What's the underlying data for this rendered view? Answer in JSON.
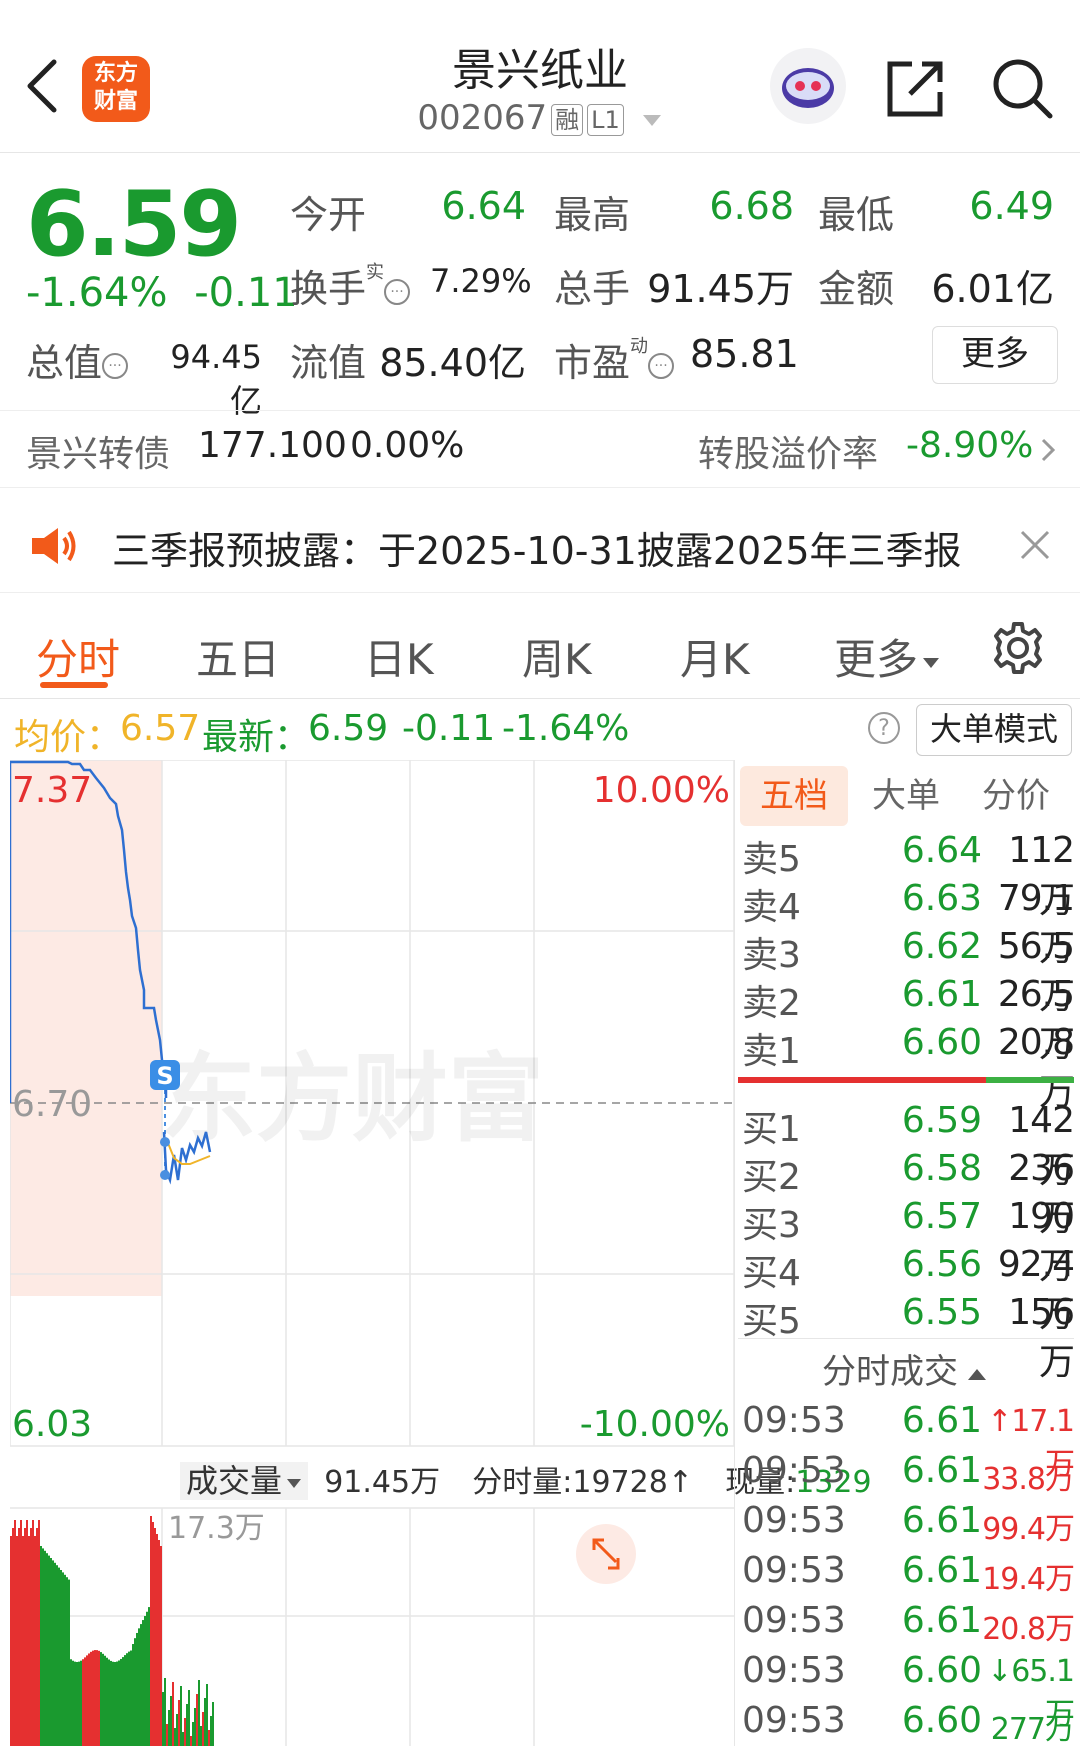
{
  "header": {
    "logo_text_1": "东方",
    "logo_text_2": "财富",
    "stock_name": "景兴纸业",
    "stock_code": "002067",
    "tag_margin": "融",
    "tag_level": "L1"
  },
  "quote": {
    "price": "6.59",
    "change_pct": "-1.64%",
    "change": "-0.11",
    "open_label": "今开",
    "open": "6.64",
    "high_label": "最高",
    "high": "6.68",
    "low_label": "最低",
    "low": "6.49",
    "turnover_label": "换手",
    "turnover_sup": "实",
    "turnover": "7.29%",
    "volume_label": "总手",
    "volume": "91.45万",
    "amount_label": "金额",
    "amount": "6.01亿",
    "mktcap_label": "总值",
    "mktcap": "94.45亿",
    "float_label": "流值",
    "float_cap": "85.40亿",
    "pe_label": "市盈",
    "pe_sup": "动",
    "pe": "85.81",
    "more_button": "更多"
  },
  "bond": {
    "name": "景兴转债",
    "price": "177.100",
    "change": "0.00%",
    "premium_label": "转股溢价率",
    "premium": "-8.90%"
  },
  "notice": {
    "text": "三季报预披露：于2025-10-31披露2025年三季报"
  },
  "tabs": [
    "分时",
    "五日",
    "日K",
    "周K",
    "月K",
    "更多"
  ],
  "info_line": {
    "avg_label": "均价：",
    "avg": "6.57",
    "latest_label": "最新：",
    "latest": "6.59",
    "change": "-0.11",
    "change_pct": "-1.64%",
    "mode_button": "大单模式"
  },
  "depth": {
    "tabs": [
      "五档",
      "大单",
      "分价"
    ],
    "asks": [
      {
        "label": "卖5",
        "price": "6.64",
        "vol": "112万"
      },
      {
        "label": "卖4",
        "price": "6.63",
        "vol": "79.1万"
      },
      {
        "label": "卖3",
        "price": "6.62",
        "vol": "56.5万"
      },
      {
        "label": "卖2",
        "price": "6.61",
        "vol": "26.5万"
      },
      {
        "label": "卖1",
        "price": "6.60",
        "vol": "20.8万"
      }
    ],
    "bids": [
      {
        "label": "买1",
        "price": "6.59",
        "vol": "142万"
      },
      {
        "label": "买2",
        "price": "6.58",
        "vol": "236万"
      },
      {
        "label": "买3",
        "price": "6.57",
        "vol": "190万"
      },
      {
        "label": "买4",
        "price": "6.56",
        "vol": "92.4万"
      },
      {
        "label": "买5",
        "price": "6.55",
        "vol": "156万"
      }
    ],
    "ticks_title": "分时成交",
    "ticks": [
      {
        "time": "09:53",
        "price": "6.61",
        "arrow": "↑",
        "vol": "17.1万",
        "color": "red"
      },
      {
        "time": "09:53",
        "price": "6.61",
        "arrow": "",
        "vol": "33.8万",
        "color": "red"
      },
      {
        "time": "09:53",
        "price": "6.61",
        "arrow": "",
        "vol": "99.4万",
        "color": "red"
      },
      {
        "time": "09:53",
        "price": "6.61",
        "arrow": "",
        "vol": "19.4万",
        "color": "red"
      },
      {
        "time": "09:53",
        "price": "6.61",
        "arrow": "",
        "vol": "20.8万",
        "color": "red"
      },
      {
        "time": "09:53",
        "price": "6.60",
        "arrow": "↓",
        "vol": "65.1万",
        "color": "green"
      },
      {
        "time": "09:53",
        "price": "6.60",
        "arrow": "",
        "vol": "277万",
        "color": "green"
      }
    ]
  },
  "chart": {
    "y_max": "7.37",
    "y_mid": "6.70",
    "y_min": "6.03",
    "pct_max": "10.00%",
    "pct_min": "-10.00%",
    "watermark": "东方财富",
    "marker": "S",
    "vol_label": "成交量",
    "vol_total": "91.45万",
    "vol_tick_label": "分时量:19728↑",
    "vol_now_label": "现量:",
    "vol_now": "1329",
    "vol_max": "17.3万",
    "colors": {
      "up": "#e53030",
      "down": "#1a9a2f",
      "line": "#2e6fd1",
      "avg": "#f0b429"
    }
  }
}
